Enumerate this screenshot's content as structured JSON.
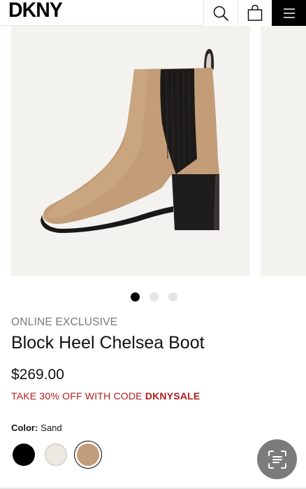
{
  "header": {
    "logo": "DKNY",
    "icons": [
      "search-icon",
      "bag-icon",
      "menu-icon"
    ]
  },
  "gallery": {
    "image": "tan suede block heel chelsea boot with black elastic gore",
    "dots_total": 3,
    "active_dot": 1
  },
  "product": {
    "badge": "ONLINE EXCLUSIVE",
    "title": "Block Heel Chelsea Boot",
    "price": "$269.00",
    "promo_prefix": "TAKE 30% OFF WITH CODE ",
    "promo_code": "DKNYSALE"
  },
  "color": {
    "label": "Color:",
    "selected": "Sand",
    "swatches": [
      {
        "hex": "#000000"
      },
      {
        "hex": "#ece7e1"
      },
      {
        "hex": "#c19c7b"
      }
    ]
  },
  "colors": {
    "promo": "#b31b1b",
    "fab": "#7b7b7b"
  }
}
